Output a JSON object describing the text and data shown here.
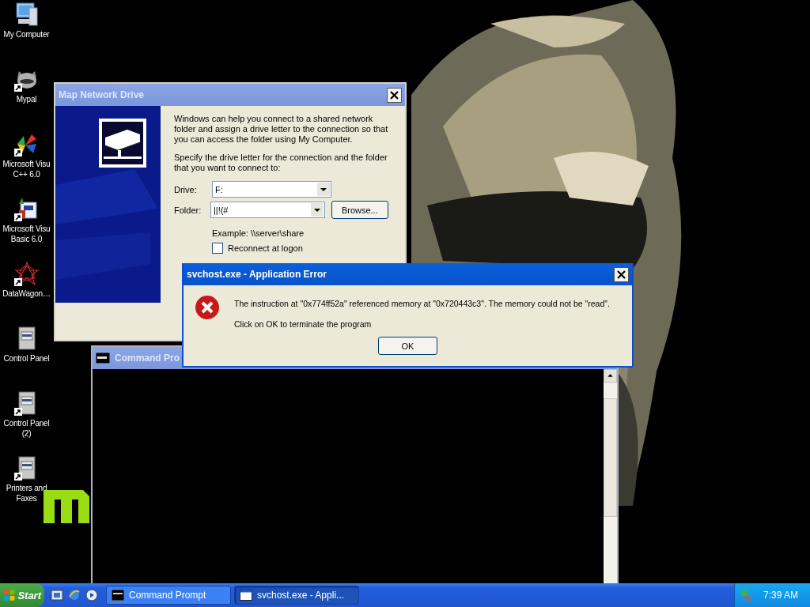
{
  "desktop_icons": [
    {
      "label": "My Computer",
      "kind": "computer",
      "shortcut": false
    },
    {
      "label": "Mypal",
      "kind": "animal",
      "shortcut": true
    },
    {
      "label": "Microsoft Visu\nC++ 6.0",
      "kind": "pinwheel",
      "shortcut": true
    },
    {
      "label": "Microsoft Visu\nBasic 6.0",
      "kind": "basic",
      "shortcut": true
    },
    {
      "label": "DataWagon…",
      "kind": "star",
      "shortcut": true
    },
    {
      "label": "Control Panel",
      "kind": "panel",
      "shortcut": false
    },
    {
      "label": "Control Panel\n(2)",
      "kind": "panel",
      "shortcut": true
    },
    {
      "label": "Printers and\nFaxes",
      "kind": "panel",
      "shortcut": true
    }
  ],
  "map_drive": {
    "title": "Map Network Drive",
    "intro": "Windows can help you connect to a shared network folder and assign a drive letter to the connection so that you can access the folder using My Computer.",
    "instruction": "Specify the drive letter for the connection and the folder that you want to connect to:",
    "drive_label": "Drive:",
    "drive_value": "F:",
    "folder_label": "Folder:",
    "folder_value": "||!(#",
    "browse": "Browse...",
    "example": "Example: \\\\server\\share",
    "reconnect": {
      "label": "Reconnect at logon",
      "checked": false
    }
  },
  "command_prompt": {
    "title": "Command Pro"
  },
  "error_dialog": {
    "title": "svchost.exe - Application Error",
    "message": "The instruction at \"0x774ff52a\" referenced memory at \"0x720443c3\". The memory could not be \"read\".",
    "hint": "Click on OK to terminate the program",
    "ok": "OK"
  },
  "taskbar": {
    "start": "Start",
    "tasks": [
      {
        "label": "Command Prompt",
        "kind": "console",
        "selected": false
      },
      {
        "label": "svchost.exe - Appli...",
        "kind": "window",
        "selected": true
      }
    ],
    "time": "7:39 AM"
  }
}
